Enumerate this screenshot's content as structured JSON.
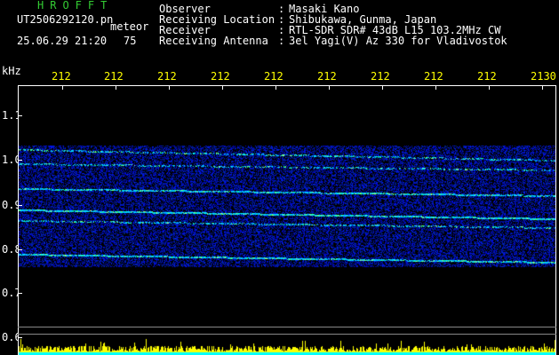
{
  "header": {
    "brand": "HROFFT",
    "file_name": "UT2506292120.pn",
    "type": "meteor",
    "datetime": "25.06.29 21:20",
    "count": "75",
    "info": [
      {
        "label": "Observer",
        "value": "Masaki Kano"
      },
      {
        "label": "Receiving Location",
        "value": "Shibukawa, Gunma, Japan"
      },
      {
        "label": "Receiver",
        "value": "RTL-SDR SDR# 43dB L15 103.2MHz CW"
      },
      {
        "label": "Receiving Antenna",
        "value": "3el Yagi(V) Az 330 for Vladivostok"
      }
    ],
    "colon": ":"
  },
  "axes": {
    "y_unit": "kHz",
    "x_ticks": [
      "212",
      "212",
      "212",
      "212",
      "212",
      "212",
      "212",
      "212",
      "212",
      "2130"
    ],
    "y_ticks": [
      "1.1",
      "1.0",
      "0.9",
      "0.8",
      "0.7",
      "0.6"
    ]
  },
  "colors": {
    "background": "#000000",
    "text_white": "#ffffff",
    "text_green": "#33cc33",
    "text_yellow": "#ffff00",
    "trace_low": "#0000cc",
    "trace_high": "#00ffff",
    "strip": "#ffff00",
    "strip_base": "#00ffff"
  }
}
